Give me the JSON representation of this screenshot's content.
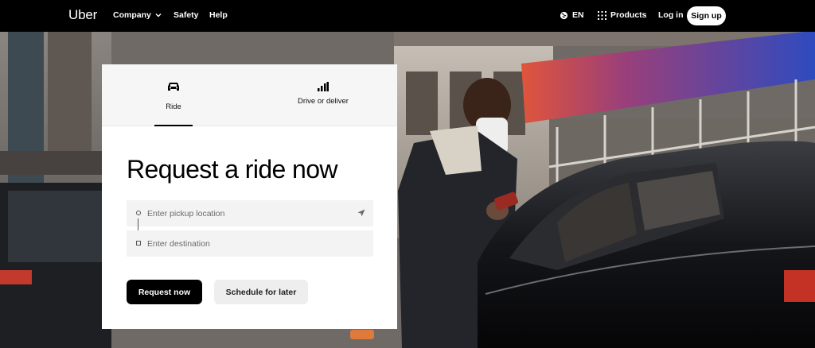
{
  "nav": {
    "logo": "Uber",
    "company": "Company",
    "safety": "Safety",
    "help": "Help",
    "language": "EN",
    "products": "Products",
    "login": "Log in",
    "signup": "Sign up"
  },
  "card": {
    "tabs": [
      {
        "label": "Ride",
        "icon": "car-icon",
        "selected": true
      },
      {
        "label": "Drive or deliver",
        "icon": "bars-icon",
        "selected": false
      }
    ],
    "headline": "Request a ride now",
    "pickup": {
      "placeholder": "Enter pickup location",
      "value": ""
    },
    "destination": {
      "placeholder": "Enter destination",
      "value": ""
    },
    "request_button": "Request now",
    "schedule_button": "Schedule for later"
  },
  "colors": {
    "nav_bg": "#000000",
    "card_bg": "#ffffff",
    "primary_button": "#000000",
    "secondary_button": "#eeeeee",
    "awning": "#2e4bbf"
  }
}
